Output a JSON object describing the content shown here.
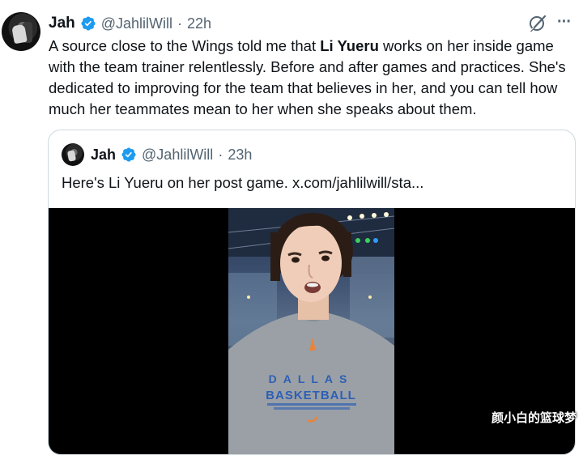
{
  "tweet": {
    "author_name": "Jah",
    "handle": "@JahlilWill",
    "separator": "·",
    "time": "22h",
    "text_before": "A source close to the Wings told me that ",
    "text_bold": "Li Yueru",
    "text_after": " works on her inside game with the team trainer relentlessly. Before and after games and practices. She's dedicated to improving for the team that believes in her, and you can tell how much her teammates mean to her when she speaks about them.",
    "more_label": "···"
  },
  "quoted": {
    "author_name": "Jah",
    "handle": "@JahlilWill",
    "separator": "·",
    "time": "23h",
    "text": "Here's Li Yueru on her post game.  x.com/jahlilwill/sta..."
  },
  "video": {
    "shirt_line1": "DALLAS",
    "shirt_line2": "BASKETBALL"
  },
  "watermark": "颜小白的篮球梦",
  "colors": {
    "verified": "#1d9bf0",
    "secondary_text": "#536471",
    "border": "#cfd9de"
  },
  "icons": [
    "avatar",
    "verified-badge-icon",
    "grok-icon",
    "more-icon"
  ]
}
